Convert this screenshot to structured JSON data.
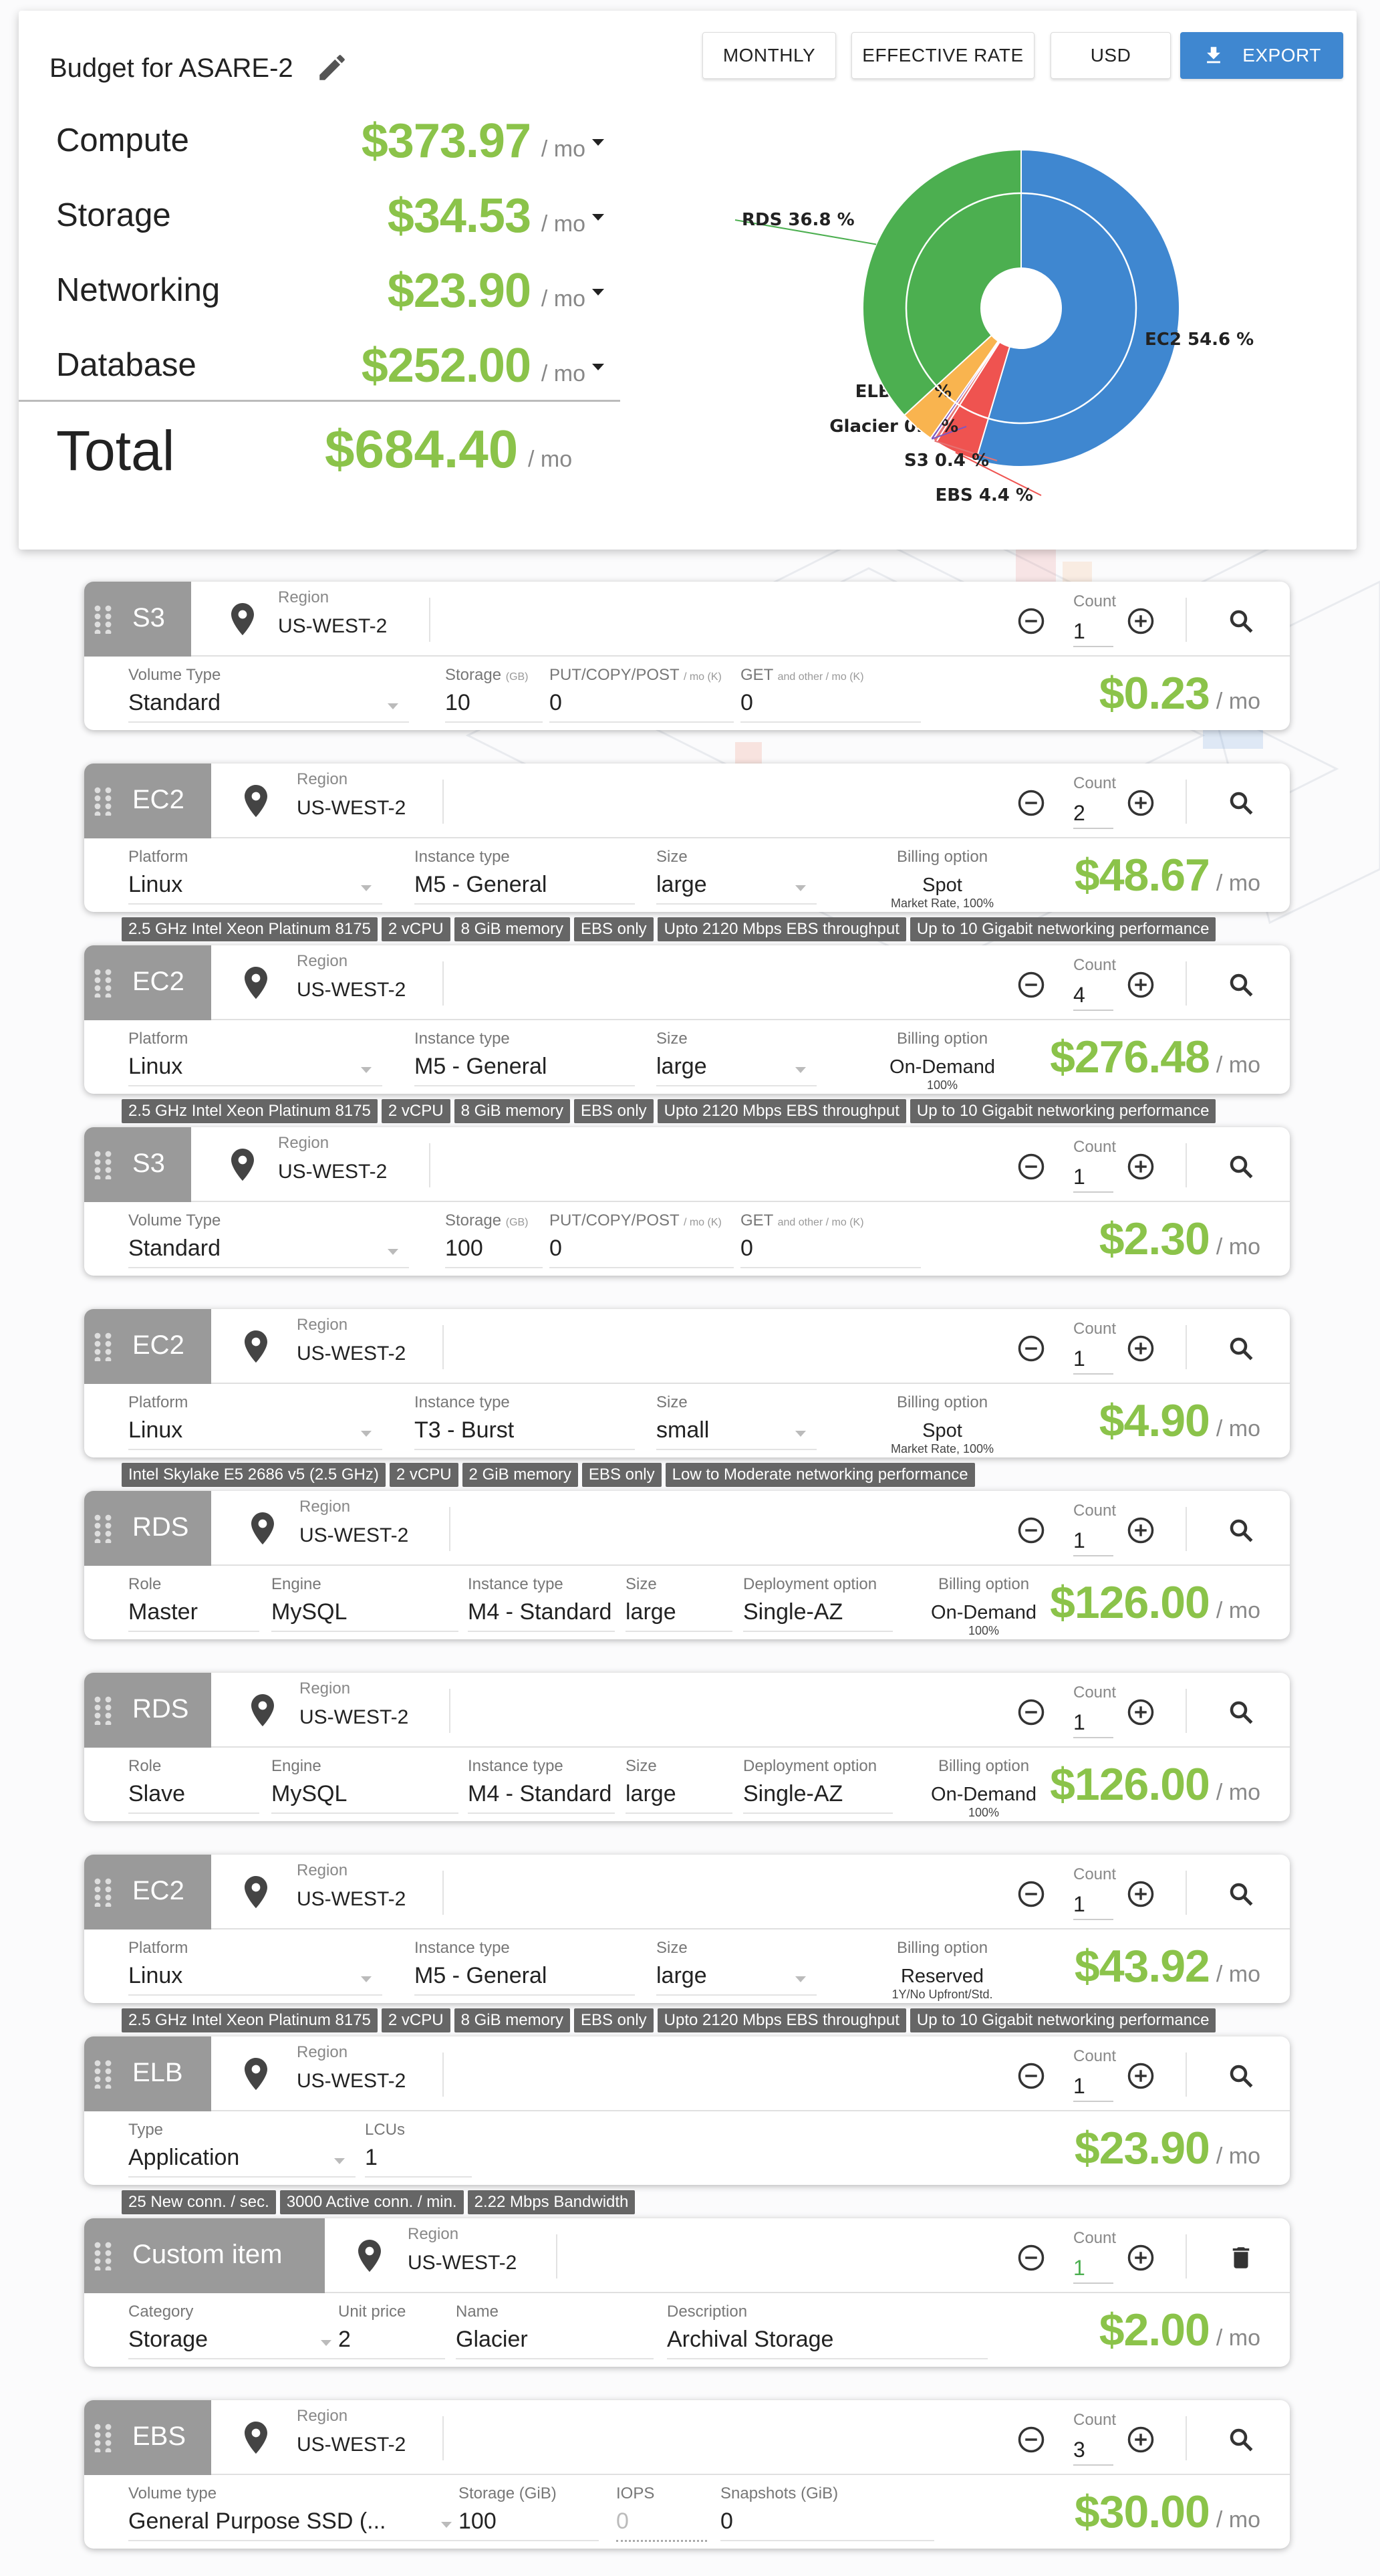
{
  "header": {
    "title": "Budget for ASARE-2",
    "buttons": {
      "monthly": "MONTHLY",
      "effective_rate": "EFFECTIVE RATE",
      "currency": "USD",
      "export": "EXPORT"
    }
  },
  "summary": {
    "rows": [
      {
        "label": "Compute",
        "value": "$373.97",
        "period": "/ mo"
      },
      {
        "label": "Storage",
        "value": "$34.53",
        "period": "/ mo"
      },
      {
        "label": "Networking",
        "value": "$23.90",
        "period": "/ mo"
      },
      {
        "label": "Database",
        "value": "$252.00",
        "period": "/ mo"
      }
    ],
    "total": {
      "label": "Total",
      "value": "$684.40",
      "period": "/ mo"
    }
  },
  "chart_data": {
    "type": "pie",
    "slices": [
      {
        "label": "EC2 54.6 %",
        "name": "EC2",
        "value": 54.6,
        "color": "#3f87d0"
      },
      {
        "label": "EBS 4.4 %",
        "name": "EBS",
        "value": 4.4,
        "color": "#ef5350"
      },
      {
        "label": "S3 0.4 %",
        "name": "S3",
        "value": 0.4,
        "color": "#e57373"
      },
      {
        "label": "Glacier 0.3 %",
        "name": "Glacier",
        "value": 0.3,
        "color": "#7e57c2"
      },
      {
        "label": "ELB 3.5 %",
        "name": "ELB",
        "value": 3.5,
        "color": "#f9b44f"
      },
      {
        "label": "RDS 36.8 %",
        "name": "RDS",
        "value": 36.8,
        "color": "#4caf50"
      }
    ]
  },
  "common": {
    "region_label": "Region",
    "count_label": "Count",
    "period": "/ mo"
  },
  "items": [
    {
      "tag": "S3",
      "region": "US-WEST-2",
      "count": "1",
      "fields": [
        {
          "label": "Volume Type",
          "value": "Standard"
        },
        {
          "label": "Storage",
          "sub": "(GB)",
          "value": "10"
        },
        {
          "label": "PUT/COPY/POST",
          "sub": "/ mo (K)",
          "value": "0"
        },
        {
          "label": "GET",
          "sub": "and other / mo (K)",
          "value": "0"
        }
      ],
      "price": "$0.23"
    },
    {
      "tag": "EC2",
      "region": "US-WEST-2",
      "count": "2",
      "fields": [
        {
          "label": "Platform",
          "value": "Linux"
        },
        {
          "label": "Instance type",
          "value": "M5 - General"
        },
        {
          "label": "Size",
          "value": "large"
        }
      ],
      "billing": {
        "label": "Billing option",
        "value": "Spot",
        "sub": "Market Rate, 100%"
      },
      "price": "$48.67",
      "chips": [
        "2.5 GHz Intel Xeon Platinum 8175",
        "2 vCPU",
        "8 GiB memory",
        "EBS only",
        "Upto 2120 Mbps EBS throughput",
        "Up to 10 Gigabit networking performance"
      ]
    },
    {
      "tag": "EC2",
      "region": "US-WEST-2",
      "count": "4",
      "fields": [
        {
          "label": "Platform",
          "value": "Linux"
        },
        {
          "label": "Instance type",
          "value": "M5 - General"
        },
        {
          "label": "Size",
          "value": "large"
        }
      ],
      "billing": {
        "label": "Billing option",
        "value": "On-Demand",
        "sub": "100%"
      },
      "price": "$276.48",
      "chips": [
        "2.5 GHz Intel Xeon Platinum 8175",
        "2 vCPU",
        "8 GiB memory",
        "EBS only",
        "Upto 2120 Mbps EBS throughput",
        "Up to 10 Gigabit networking performance"
      ]
    },
    {
      "tag": "S3",
      "region": "US-WEST-2",
      "count": "1",
      "fields": [
        {
          "label": "Volume Type",
          "value": "Standard"
        },
        {
          "label": "Storage",
          "sub": "(GB)",
          "value": "100"
        },
        {
          "label": "PUT/COPY/POST",
          "sub": "/ mo (K)",
          "value": "0"
        },
        {
          "label": "GET",
          "sub": "and other / mo (K)",
          "value": "0"
        }
      ],
      "price": "$2.30"
    },
    {
      "tag": "EC2",
      "region": "US-WEST-2",
      "count": "1",
      "fields": [
        {
          "label": "Platform",
          "value": "Linux"
        },
        {
          "label": "Instance type",
          "value": "T3 - Burst"
        },
        {
          "label": "Size",
          "value": "small"
        }
      ],
      "billing": {
        "label": "Billing option",
        "value": "Spot",
        "sub": "Market Rate, 100%"
      },
      "price": "$4.90",
      "chips": [
        "Intel Skylake E5 2686 v5 (2.5 GHz)",
        "2 vCPU",
        "2 GiB memory",
        "EBS only",
        "Low to Moderate networking performance"
      ]
    },
    {
      "tag": "RDS",
      "region": "US-WEST-2",
      "count": "1",
      "fields": [
        {
          "label": "Role",
          "value": "Master"
        },
        {
          "label": "Engine",
          "value": "MySQL"
        },
        {
          "label": "Instance type",
          "value": "M4 - Standard"
        },
        {
          "label": "Size",
          "value": "large"
        },
        {
          "label": "Deployment option",
          "value": "Single-AZ"
        }
      ],
      "billing": {
        "label": "Billing option",
        "value": "On-Demand",
        "sub": "100%"
      },
      "price": "$126.00"
    },
    {
      "tag": "RDS",
      "region": "US-WEST-2",
      "count": "1",
      "fields": [
        {
          "label": "Role",
          "value": "Slave"
        },
        {
          "label": "Engine",
          "value": "MySQL"
        },
        {
          "label": "Instance type",
          "value": "M4 - Standard"
        },
        {
          "label": "Size",
          "value": "large"
        },
        {
          "label": "Deployment option",
          "value": "Single-AZ"
        }
      ],
      "billing": {
        "label": "Billing option",
        "value": "On-Demand",
        "sub": "100%"
      },
      "price": "$126.00"
    },
    {
      "tag": "EC2",
      "region": "US-WEST-2",
      "count": "1",
      "fields": [
        {
          "label": "Platform",
          "value": "Linux"
        },
        {
          "label": "Instance type",
          "value": "M5 - General"
        },
        {
          "label": "Size",
          "value": "large"
        }
      ],
      "billing": {
        "label": "Billing option",
        "value": "Reserved",
        "sub": "1Y/No Upfront/Std."
      },
      "price": "$43.92",
      "chips": [
        "2.5 GHz Intel Xeon Platinum 8175",
        "2 vCPU",
        "8 GiB memory",
        "EBS only",
        "Upto 2120 Mbps EBS throughput",
        "Up to 10 Gigabit networking performance"
      ]
    },
    {
      "tag": "ELB",
      "region": "US-WEST-2",
      "count": "1",
      "fields": [
        {
          "label": "Type",
          "value": "Application"
        },
        {
          "label": "LCUs",
          "value": "1"
        }
      ],
      "price": "$23.90",
      "chips": [
        "25 New conn. / sec.",
        "3000 Active conn. / min.",
        "2.22 Mbps Bandwidth"
      ]
    },
    {
      "tag": "Custom item",
      "region": "US-WEST-2",
      "count": "1",
      "fields": [
        {
          "label": "Category",
          "value": "Storage"
        },
        {
          "label": "Unit price",
          "value": "2"
        },
        {
          "label": "Name",
          "value": "Glacier"
        },
        {
          "label": "Description",
          "value": "Archival Storage"
        }
      ],
      "price": "$2.00"
    },
    {
      "tag": "EBS",
      "region": "US-WEST-2",
      "count": "3",
      "fields": [
        {
          "label": "Volume type",
          "value": "General Purpose SSD (..."
        },
        {
          "label": "Storage (GiB)",
          "value": "100"
        },
        {
          "label": "IOPS",
          "value": "0"
        },
        {
          "label": "Snapshots (GiB)",
          "value": "0"
        }
      ],
      "price": "$30.00"
    }
  ]
}
